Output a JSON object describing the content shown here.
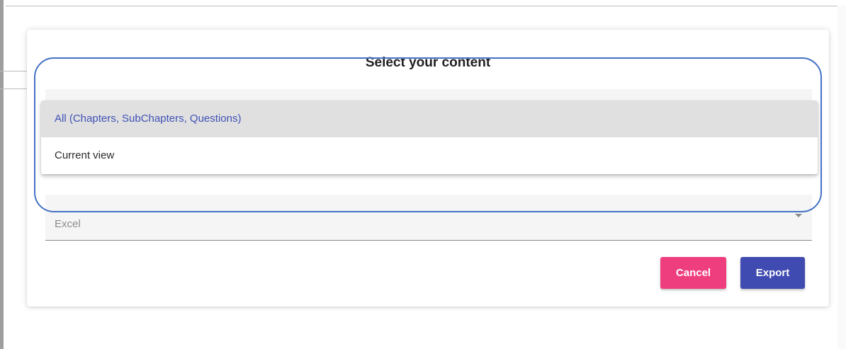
{
  "dialog": {
    "title": "Select your content",
    "format_select": {
      "value": "Excel"
    },
    "buttons": {
      "cancel_label": "Cancel",
      "export_label": "Export"
    }
  },
  "dropdown": {
    "options": [
      {
        "label": "All (Chapters, SubChapters, Questions)",
        "selected": true
      },
      {
        "label": "Current view",
        "selected": false
      }
    ]
  },
  "colors": {
    "cancel": "#ee3e7d",
    "export": "#3f4bb0",
    "selected_option_text": "#3f51b5",
    "highlight_annotation": "#4472c4"
  },
  "icons": {
    "select_arrow": "caret-down-icon"
  }
}
